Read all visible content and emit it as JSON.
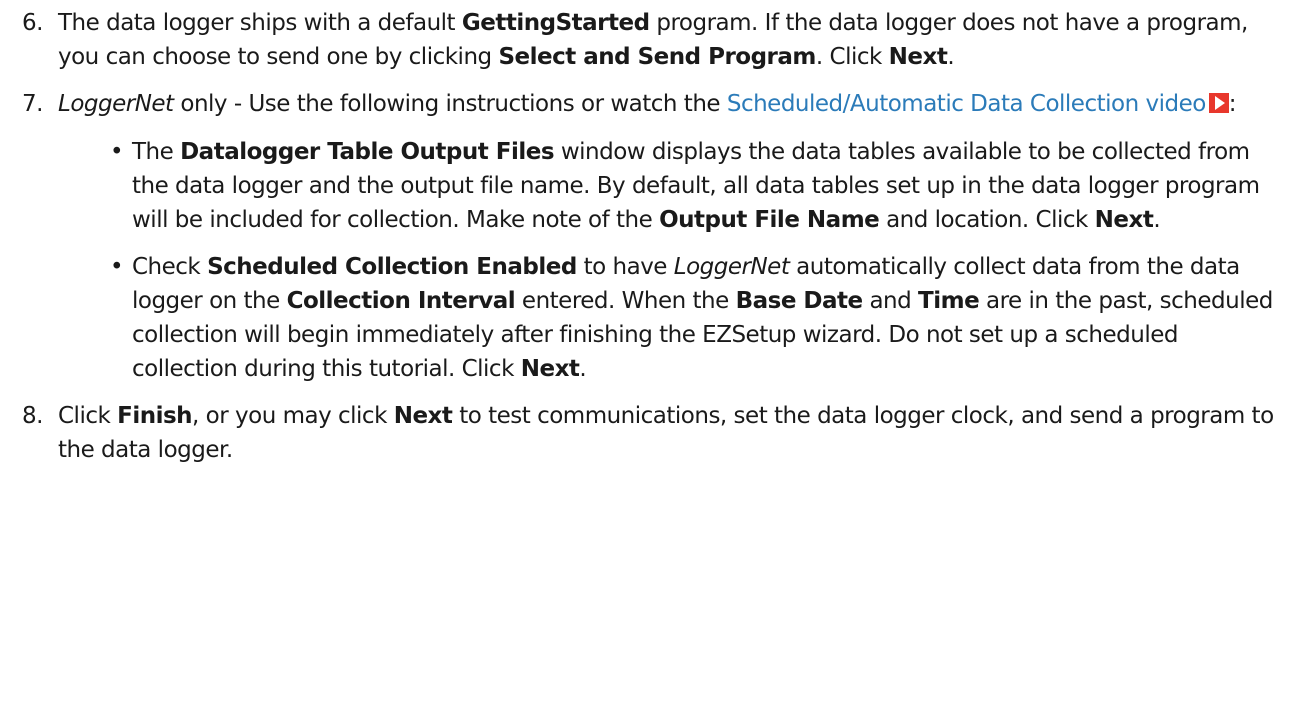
{
  "steps": [
    {
      "num": "6.",
      "parts": [
        "The data logger ships with a default ",
        "GettingStarted",
        " program. If the data logger does not have a program, you can choose to send one by clicking ",
        "Select and Send Program",
        ". Click ",
        "Next",
        "."
      ]
    },
    {
      "num": "7.",
      "parts": [
        "LoggerNet",
        " only - Use the following instructions or watch the ",
        "Scheduled/Automatic Data Collection video",
        ":"
      ],
      "video_icon": "video-play-icon",
      "bullets": [
        {
          "parts": [
            "The ",
            "Datalogger Table Output Files",
            " window displays the data tables available to be collected from the data logger and the output file name. By default, all data tables set up in the data logger program will be included for collection. Make note of the ",
            "Output File Name",
            " and location. Click ",
            "Next",
            "."
          ]
        },
        {
          "parts": [
            "Check ",
            "Scheduled Collection Enabled",
            " to have ",
            "LoggerNet",
            " automatically collect data from the data logger on the ",
            "Collection Interval",
            " entered. When the ",
            "Base Date",
            " and ",
            "Time",
            " are in the past, scheduled collection will begin immediately after finishing the EZSetup wizard. Do not set up a scheduled collection during this tutorial. Click ",
            "Next",
            "."
          ]
        }
      ]
    },
    {
      "num": "8.",
      "parts": [
        "Click ",
        "Finish",
        ", or you may click ",
        "Next",
        " to test communications, set the data logger clock, and send a program to the data logger."
      ]
    }
  ],
  "bullet_glyph": "•",
  "colors": {
    "link": "#2b7bb9",
    "video_icon_bg": "#e8372c",
    "text": "#1a1a1a"
  }
}
